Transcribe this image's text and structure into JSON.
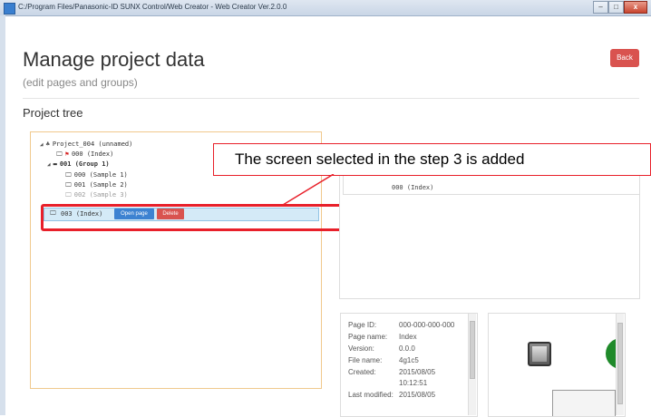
{
  "window": {
    "title": "C:/Program Files/Panasonic-ID SUNX Control/Web Creator - Web Creator Ver.2.0.0",
    "controls": [
      "–",
      "□",
      "x"
    ]
  },
  "header": {
    "title": "Manage project data",
    "subtitle": "(edit pages and groups)",
    "back_label": "Back",
    "back_color": "#d9534f"
  },
  "section": {
    "title": "Project tree"
  },
  "tree": [
    {
      "text": "Project_004 (unnamed)",
      "icon": "sitemap-icon",
      "expanded": true
    },
    {
      "text": "000 (Index)",
      "icon": "monitor-flag-icon"
    },
    {
      "text": "001 (Group 1)",
      "icon": "folder-icon",
      "expanded": true,
      "bold": true
    },
    {
      "text": "000 (Sample 1)",
      "icon": "monitor-icon"
    },
    {
      "text": "001 (Sample 2)",
      "icon": "monitor-icon"
    },
    {
      "text": "002 (Sample 3)",
      "icon": "monitor-icon"
    }
  ],
  "selected_row": {
    "text": "003 (Index)",
    "open_label": "Open page",
    "delete_label": "Delete"
  },
  "callout": {
    "text": "The screen selected in the step 3 is added"
  },
  "pages_list": {
    "item": "000 (Index)"
  },
  "details": {
    "rows": [
      {
        "label": "Page ID:",
        "value": "000-000-000-000"
      },
      {
        "label": "Page name:",
        "value": "Index"
      },
      {
        "label": "Version:",
        "value": "0.0.0"
      },
      {
        "label": "File name:",
        "value": "4g1c5"
      },
      {
        "label": "Created:",
        "value": "2015/08/05"
      },
      {
        "label": "",
        "value": "10:12:51"
      },
      {
        "label": "Last modified:",
        "value": "2015/08/05"
      }
    ]
  },
  "colors": {
    "highlight": "#e8202a",
    "open_button": "#3d82d1",
    "delete_button": "#d9534f",
    "tree_border": "#f0c98d"
  }
}
